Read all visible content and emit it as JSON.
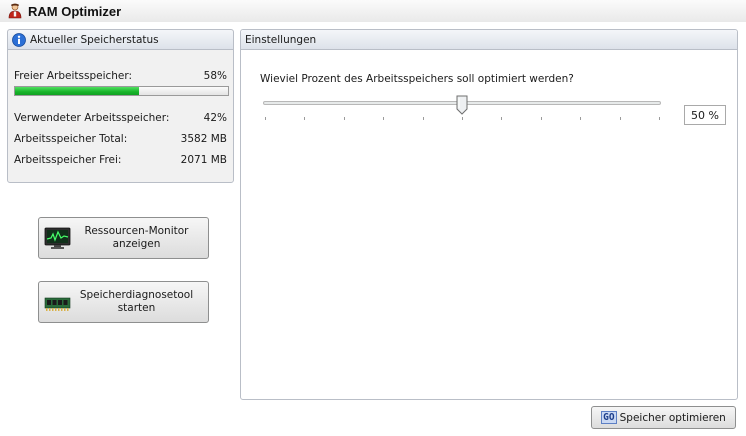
{
  "window": {
    "title": "RAM Optimizer",
    "app_icon": "ram-optimizer-user-icon"
  },
  "status_panel": {
    "header": "Aktueller Speicherstatus",
    "header_icon": "info-icon",
    "free_label": "Freier Arbeitsspeicher:",
    "free_percent": "58%",
    "free_fraction": 0.58,
    "used_label": "Verwendeter Arbeitsspeicher:",
    "used_percent": "42%",
    "total_label": "Arbeitsspeicher Total:",
    "total_value": "3582 MB",
    "free_mb_label": "Arbeitsspeicher Frei:",
    "free_mb_value": "2071 MB",
    "bar_color": "#18b42a"
  },
  "tools": {
    "resource_monitor": {
      "label": "Ressourcen-Monitor\nanzeigen",
      "icon": "resource-monitor-icon"
    },
    "memory_diagnostic": {
      "label": "Speicherdiagnosetool\nstarten",
      "icon": "memory-chip-icon"
    }
  },
  "settings": {
    "header": "Einstellungen",
    "question": "Wieviel Prozent des Arbeitsspeichers soll optimiert werden?",
    "slider_min": 0,
    "slider_max": 100,
    "slider_value": 50,
    "value_display": "50 %"
  },
  "footer": {
    "optimize_badge": "GO",
    "optimize_label": "Speicher optimieren"
  }
}
